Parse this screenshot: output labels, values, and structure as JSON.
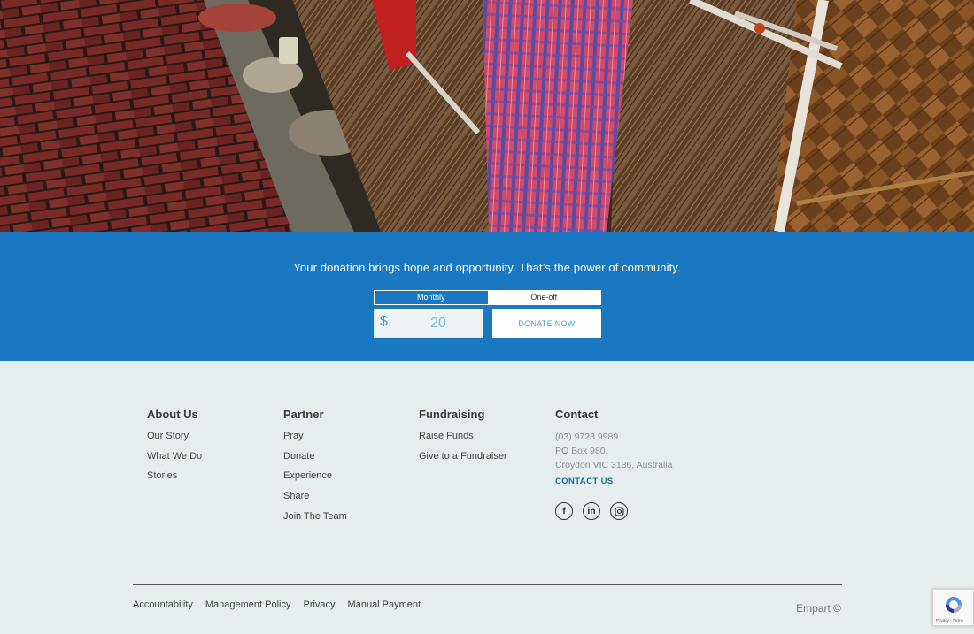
{
  "donate": {
    "tagline": "Your donation brings hope and opportunity. That’s the power of community.",
    "frequency": {
      "monthly": "Monthly",
      "oneoff": "One-off",
      "selected": "Monthly"
    },
    "currency": "$",
    "amount": "20",
    "button": "DONATE NOW"
  },
  "footer": {
    "about": {
      "title": "About Us",
      "links": [
        "Our Story",
        "What We Do",
        "Stories"
      ]
    },
    "partner": {
      "title": "Partner",
      "links": [
        "Pray",
        "Donate",
        "Experience",
        "Share",
        "Join The Team"
      ]
    },
    "fundraising": {
      "title": "Fundraising",
      "links": [
        "Raise Funds",
        "Give to a Fundraiser"
      ]
    },
    "contact": {
      "title": "Contact",
      "phone": "(03) 9723 9989",
      "address1": "PO Box 980,",
      "address2": "Croydon VIC 3136, Australia",
      "cta": "CONTACT US",
      "socials": [
        "facebook-icon",
        "linkedin-icon",
        "instagram-icon"
      ]
    },
    "bottom_links": [
      "Accountability",
      "Management Policy",
      "Privacy",
      "Manual Payment"
    ],
    "copyright": "Empart ©"
  },
  "recaptcha": {
    "terms": "Privacy - Terms"
  },
  "colors": {
    "band": "#1a78c2",
    "footer_bg": "#e6edee",
    "link_accent": "#1b6e9e"
  }
}
